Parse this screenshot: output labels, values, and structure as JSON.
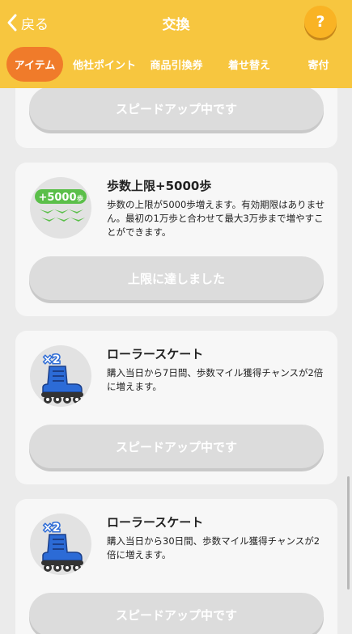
{
  "header": {
    "back_label": "戻る",
    "title": "交換",
    "help_label": "?"
  },
  "tabs": [
    {
      "label": "アイテム",
      "active": true
    },
    {
      "label": "他社ポイント",
      "active": false
    },
    {
      "label": "商品引換券",
      "active": false
    },
    {
      "label": "着せ替え",
      "active": false
    },
    {
      "label": "寄付",
      "active": false
    }
  ],
  "cards": [
    {
      "button_label": "スピードアップ中です"
    },
    {
      "badge_text": "+5000",
      "badge_unit": "歩",
      "title": "歩数上限+5000歩",
      "description": "歩数の上限が5000歩増えます。有効期限はありません。最初の1万歩と合わせて最大3万歩まで増やすことができます。",
      "button_label": "上限に達しました"
    },
    {
      "badge_text": "×2",
      "title": "ローラースケート",
      "description": "購入当日から7日間、歩数マイル獲得チャンスが2倍に増えます。",
      "button_label": "スピードアップ中です"
    },
    {
      "badge_text": "×2",
      "title": "ローラースケート",
      "description": "購入当日から30日間、歩数マイル獲得チャンスが2倍に増えます。",
      "button_label": "スピードアップ中です"
    }
  ],
  "colors": {
    "header": "#f7c63f",
    "active_tab": "#f07b2a",
    "help_button": "#f9b324",
    "disabled_button": "#dcdcdc"
  },
  "icons": [
    "chevron-left-icon",
    "question-icon",
    "footprints-icon",
    "roller-skate-icon"
  ]
}
